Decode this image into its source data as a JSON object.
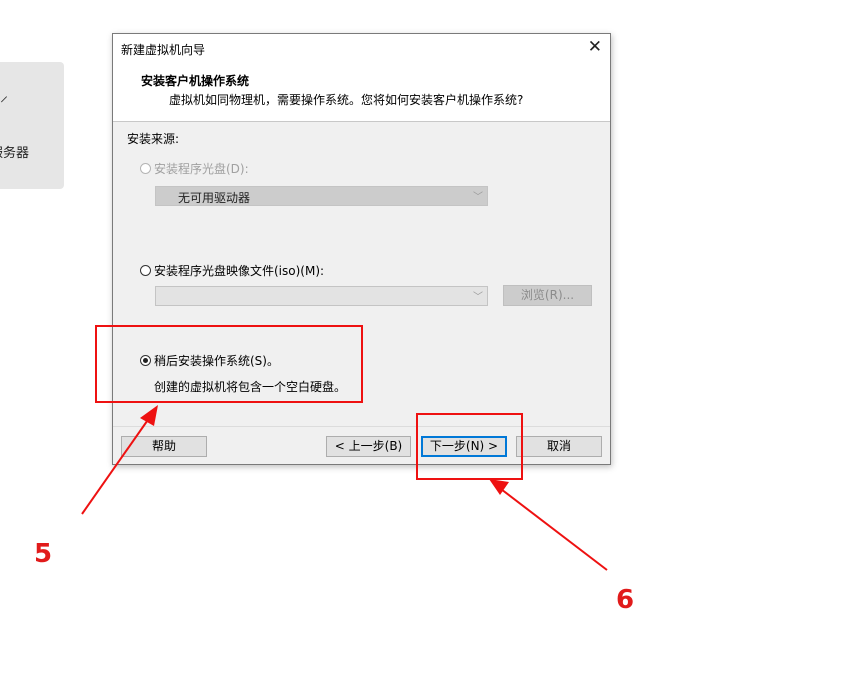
{
  "background": {
    "label": "服务器"
  },
  "dialog": {
    "title": "新建虚拟机向导",
    "header_title": "安装客户机操作系统",
    "header_subtitle": "虚拟机如同物理机，需要操作系统。您将如何安装客户机操作系统?",
    "source_label": "安装来源:",
    "option_disc": {
      "label": "安装程序光盘(D):",
      "selected": false,
      "enabled": false
    },
    "disc_combo_value": "无可用驱动器",
    "option_iso": {
      "label": "安装程序光盘映像文件(iso)(M):",
      "selected": false,
      "enabled": true
    },
    "iso_combo_value": "",
    "browse_button": "浏览(R)...",
    "option_later": {
      "label": "稍后安装操作系统(S)。",
      "selected": true,
      "enabled": true
    },
    "later_desc": "创建的虚拟机将包含一个空白硬盘。",
    "buttons": {
      "help": "帮助",
      "back": "< 上一步(B)",
      "next": "下一步(N) >",
      "cancel": "取消"
    }
  },
  "annotations": {
    "step5": "5",
    "step6": "6",
    "color": "#ee1111"
  }
}
